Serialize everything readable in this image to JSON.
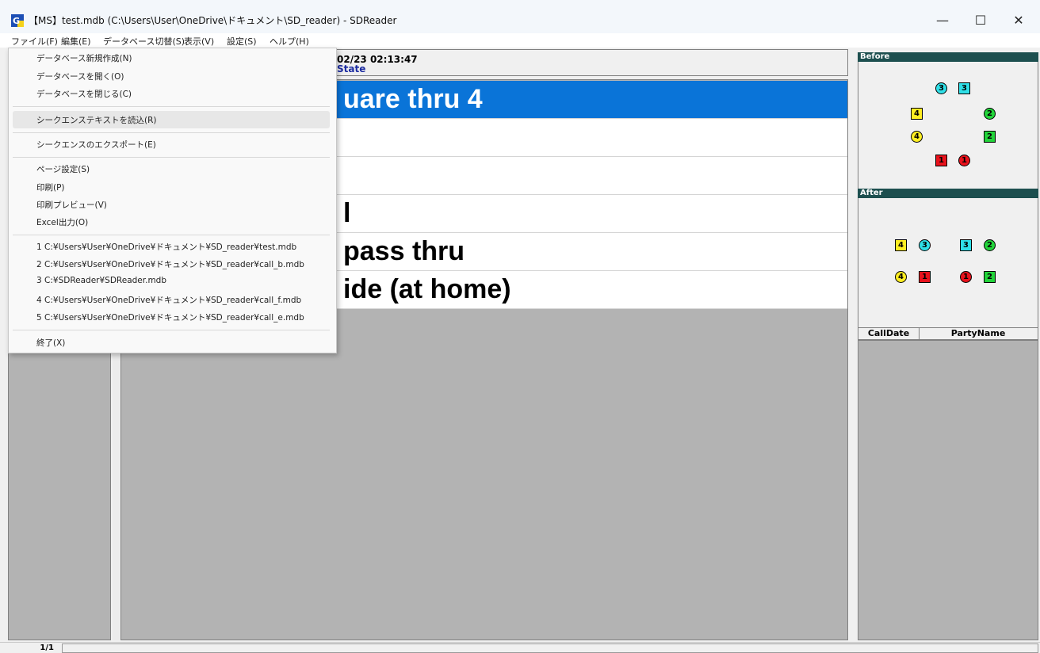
{
  "window": {
    "title": "【MS】test.mdb (C:\\Users\\User\\OneDrive\\ドキュメント\\SD_reader) - SDReader",
    "minimize_glyph": "—",
    "maximize_glyph": "☐",
    "close_glyph": "✕"
  },
  "menubar": [
    "ファイル(F)",
    "編集(E)",
    "データベース切替(S)",
    "表示(V)",
    "設定(S)",
    "ヘルプ(H)"
  ],
  "file_menu": {
    "items": [
      "データベース新規作成(N)",
      "データベースを開く(O)",
      "データベースを閉じる(C)",
      "シークエンステキストを読込(R)",
      "シークエンスのエクスポート(E)",
      "ページ設定(S)",
      "印刷(P)",
      "印刷プレビュー(V)",
      "Excel出力(O)",
      "1 C:¥Users¥User¥OneDrive¥ドキュメント¥SD_reader¥test.mdb",
      "2 C:¥Users¥User¥OneDrive¥ドキュメント¥SD_reader¥call_b.mdb",
      "3 C:¥SDReader¥SDReader.mdb",
      "4 C:¥Users¥User¥OneDrive¥ドキュメント¥SD_reader¥call_f.mdb",
      "5 C:¥Users¥User¥OneDrive¥ドキュメント¥SD_reader¥call_e.mdb",
      "終了(X)"
    ]
  },
  "header": {
    "date": "02/23 02:13:47",
    "state": "State"
  },
  "calls": [
    {
      "text": "uare thru 4",
      "selected": true
    },
    {
      "text": "",
      "selected": false
    },
    {
      "text": "",
      "selected": false
    },
    {
      "text": "l",
      "selected": false
    },
    {
      "text": "pass thru",
      "selected": false
    },
    {
      "text": "ide  (at home)",
      "selected": false
    }
  ],
  "right_panel": {
    "before_label": "Before",
    "after_label": "After",
    "table_headers": [
      "CallDate",
      "PartyName"
    ]
  },
  "dancer_colors": {
    "1": "#e8121c",
    "2": "#22d43a",
    "3": "#2fe0e8",
    "4": "#ffee22"
  },
  "status": {
    "page": "1/1"
  }
}
